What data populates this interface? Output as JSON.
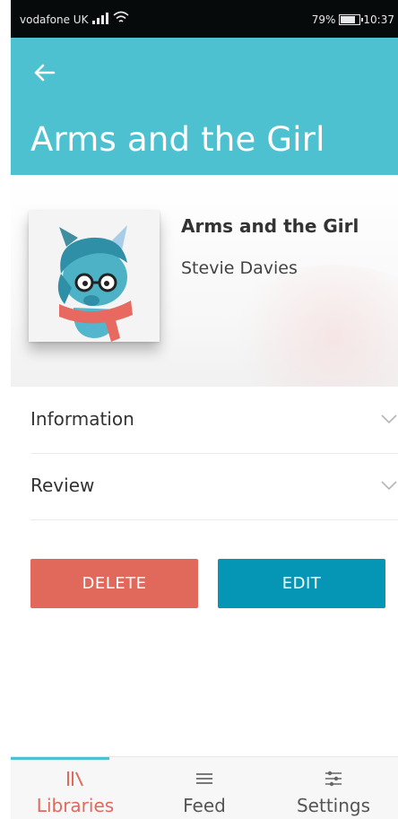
{
  "status_bar": {
    "carrier": "vodafone UK",
    "battery_percent": "79%",
    "battery_level": 0.79,
    "time": "10:37"
  },
  "app_bar": {
    "title": "Arms and the Girl",
    "back_icon": "arrow-left-icon"
  },
  "book": {
    "title": "Arms and the Girl",
    "author": "Stevie Davies",
    "cover_icon": "mascot-with-glasses-icon"
  },
  "sections": [
    {
      "label": "Information",
      "icon": "chevron-down-icon"
    },
    {
      "label": "Review",
      "icon": "chevron-down-icon"
    }
  ],
  "actions": {
    "delete_label": "DELETE",
    "edit_label": "EDIT"
  },
  "bottom_nav": {
    "items": [
      {
        "label": "Libraries",
        "icon": "library-icon",
        "active": true
      },
      {
        "label": "Feed",
        "icon": "menu-lines-icon",
        "active": false
      },
      {
        "label": "Settings",
        "icon": "sliders-icon",
        "active": false
      }
    ]
  },
  "colors": {
    "app_bar": "#4ec1d1",
    "delete_button": "#e0695c",
    "edit_button": "#0596b5",
    "active_nav": "#e0695c"
  }
}
